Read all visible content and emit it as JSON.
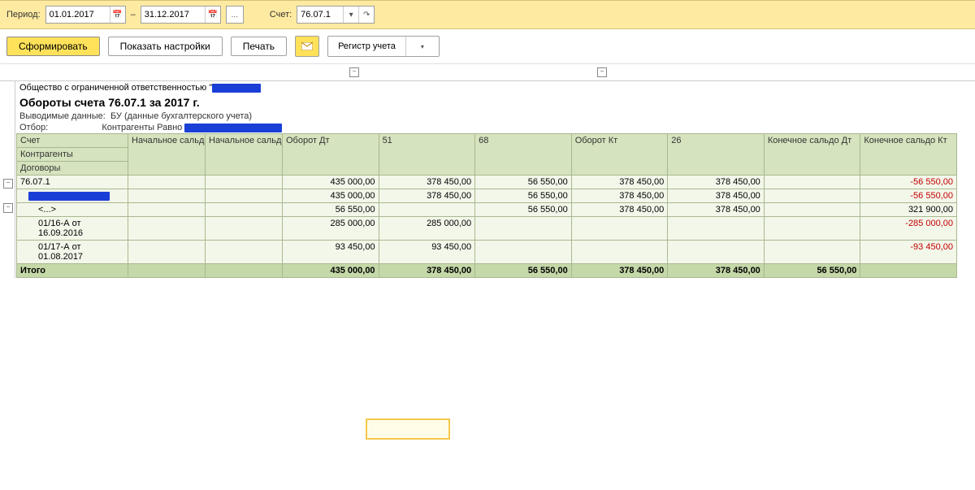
{
  "topbar": {
    "period_label": "Период:",
    "date_from": "01.01.2017",
    "dash": "–",
    "date_to": "31.12.2017",
    "account_label": "Счет:",
    "account": "76.07.1"
  },
  "toolbar": {
    "generate": "Сформировать",
    "show_settings": "Показать настройки",
    "print": "Печать",
    "register": "Регистр учета"
  },
  "report": {
    "company_prefix": "Общество с ограниченной ответственностью \"",
    "title": "Обороты счета 76.07.1 за 2017 г.",
    "output_label": "Выводимые данные:",
    "output_value": "БУ (данные бухгалтерского учета)",
    "filter_label": "Отбор:",
    "filter_value": "Контрагенты Равно"
  },
  "headers": {
    "r1c1": "Счет",
    "r1c2": "Начальное сальдо Дт",
    "r1c3": "Начальное сальдо Кт",
    "r1c4": "Оборот Дт",
    "r1c5": "51",
    "r1c6": "68",
    "r1c7": "Оборот Кт",
    "r1c8": "26",
    "r1c9": "Конечное сальдо Дт",
    "r1c10": "Конечное сальдо Кт",
    "r2c1": "Контрагенты",
    "r3c1": "Договоры"
  },
  "rows": {
    "acc": "76.07.1",
    "placeholder": "<...>",
    "contract1": "01/16-А от 16.09.2016",
    "contract2": "01/17-А от 01.08.2017",
    "total_label": "Итого",
    "r1": {
      "debit": "435 000,00",
      "c51": "378 450,00",
      "c68": "56 550,00",
      "credit": "378 450,00",
      "c26": "378 450,00",
      "end_kt": "-56 550,00"
    },
    "r2": {
      "debit": "435 000,00",
      "c51": "378 450,00",
      "c68": "56 550,00",
      "credit": "378 450,00",
      "c26": "378 450,00",
      "end_kt": "-56 550,00"
    },
    "r3": {
      "debit": "56 550,00",
      "c68": "56 550,00",
      "credit": "378 450,00",
      "c26": "378 450,00",
      "end_kt": "321 900,00"
    },
    "r4": {
      "debit": "285 000,00",
      "c51": "285 000,00",
      "end_kt": "-285 000,00"
    },
    "r5": {
      "debit": "93 450,00",
      "c51": "93 450,00",
      "end_kt": "-93 450,00"
    },
    "total": {
      "debit": "435 000,00",
      "c51": "378 450,00",
      "c68": "56 550,00",
      "credit": "378 450,00",
      "c26": "378 450,00",
      "end_dt": "56 550,00"
    }
  }
}
